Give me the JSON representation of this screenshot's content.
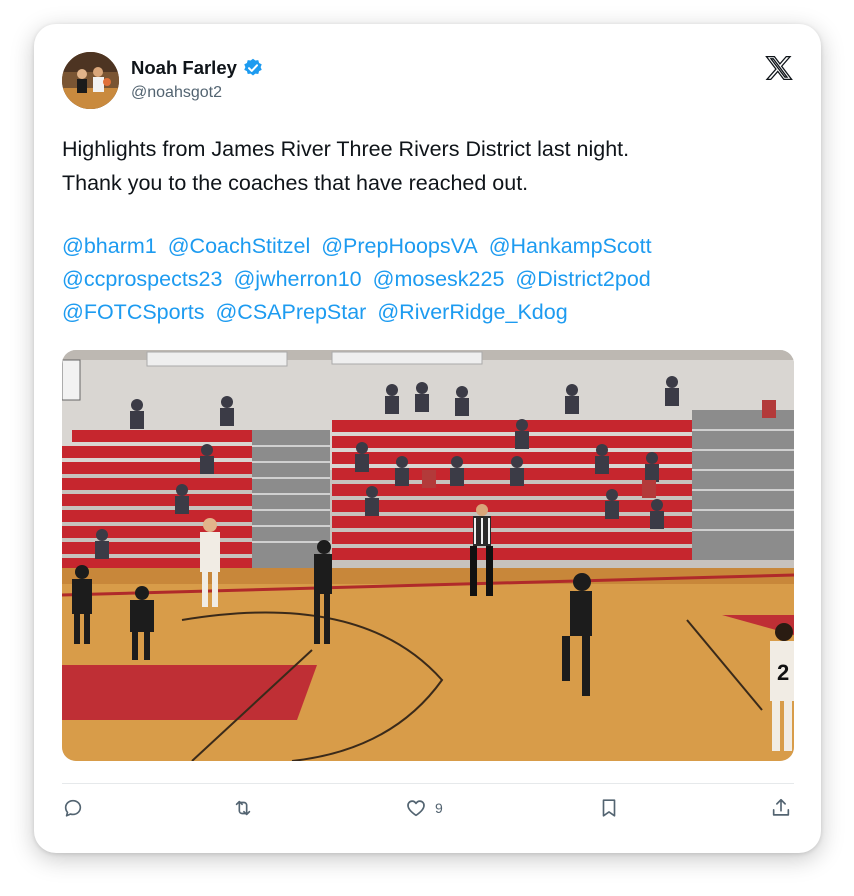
{
  "author": {
    "name": "Noah Farley",
    "handle": "@noahsgot2",
    "verified": true,
    "verified_color": "#1d9bf0"
  },
  "platform_icon": "x-logo-icon",
  "tweet": {
    "lines": [
      "Highlights from James River Three Rivers District last night.",
      "Thank you to the coaches that have reached out."
    ],
    "mentions": [
      "@bharm1",
      "@CoachStitzel",
      "@PrepHoopsVA",
      "@HankampScott",
      "@ccprospects23",
      "@jwherron10",
      "@mosesk225",
      "@District2pod",
      "@FOTCSports",
      "@CSAPrepStar",
      "@RiverRidge_Kdog"
    ],
    "mention_color": "#1d9bf0"
  },
  "media": {
    "icon": "video-thumbnail",
    "jersey_number": "2"
  },
  "actions": {
    "reply_icon": "reply-icon",
    "retweet_icon": "retweet-icon",
    "like_icon": "heart-icon",
    "like_count": "9",
    "bookmark_icon": "bookmark-icon",
    "share_icon": "share-icon"
  }
}
